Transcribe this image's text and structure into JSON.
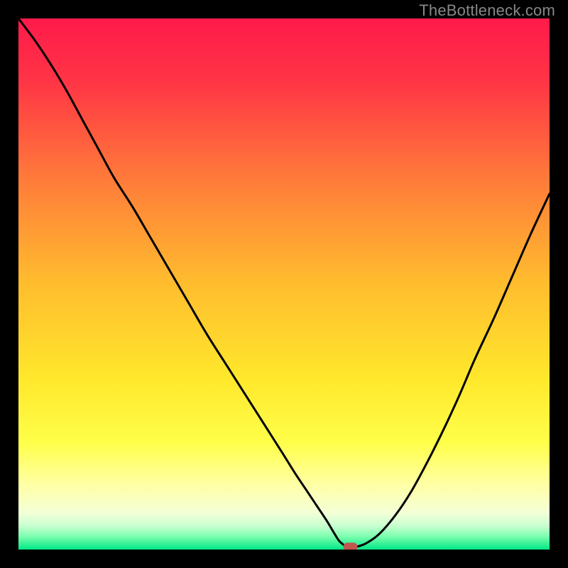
{
  "watermark": "TheBottleneck.com",
  "chart_data": {
    "type": "line",
    "title": "",
    "xlabel": "",
    "ylabel": "",
    "xlim": [
      0,
      100
    ],
    "ylim": [
      0,
      100
    ],
    "gradient_stops": [
      {
        "offset": 0.0,
        "color": "#ff1a4b"
      },
      {
        "offset": 0.12,
        "color": "#ff3545"
      },
      {
        "offset": 0.3,
        "color": "#ff7a3a"
      },
      {
        "offset": 0.5,
        "color": "#ffbd2e"
      },
      {
        "offset": 0.68,
        "color": "#ffe82c"
      },
      {
        "offset": 0.8,
        "color": "#ffff4a"
      },
      {
        "offset": 0.88,
        "color": "#ffffa8"
      },
      {
        "offset": 0.93,
        "color": "#f4ffd6"
      },
      {
        "offset": 0.955,
        "color": "#c9ffd0"
      },
      {
        "offset": 0.975,
        "color": "#7dffb0"
      },
      {
        "offset": 1.0,
        "color": "#00e884"
      }
    ],
    "series": [
      {
        "name": "bottleneck-curve",
        "x": [
          0.0,
          3.0,
          6.0,
          9.0,
          12.0,
          15.0,
          18.0,
          21.5,
          25.0,
          28.5,
          32.0,
          35.5,
          39.0,
          42.5,
          46.0,
          49.5,
          52.0,
          54.0,
          56.0,
          58.0,
          59.5,
          60.5,
          62.0,
          63.5,
          65.5,
          68.0,
          71.0,
          74.0,
          77.0,
          80.0,
          83.0,
          86.0,
          89.5,
          93.0,
          96.5,
          100.0
        ],
        "y": [
          100.0,
          96.0,
          91.5,
          86.5,
          81.0,
          75.5,
          70.0,
          64.5,
          58.5,
          52.5,
          46.5,
          40.5,
          35.0,
          29.5,
          24.0,
          18.5,
          14.5,
          11.5,
          8.5,
          5.5,
          3.0,
          1.5,
          0.5,
          0.5,
          1.2,
          3.0,
          6.5,
          11.0,
          16.5,
          22.5,
          29.0,
          36.0,
          43.5,
          51.5,
          59.5,
          67.0
        ]
      }
    ],
    "marker": {
      "name": "min-point",
      "x": 62.5,
      "y": 0.5,
      "color": "#c1564e"
    }
  }
}
